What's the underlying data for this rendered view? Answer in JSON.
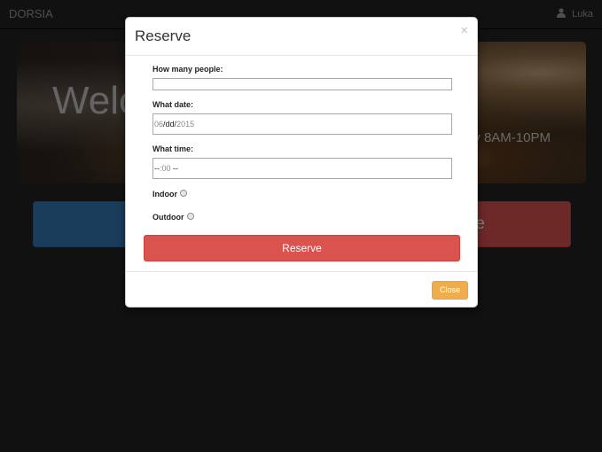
{
  "navbar": {
    "brand": "DORSIA",
    "user_name": "Luka",
    "user_icon": "user-icon"
  },
  "hero": {
    "title": "Welco",
    "hours_text": "y 8AM-10PM"
  },
  "background_buttons": {
    "red_label": "e"
  },
  "modal": {
    "title": "Reserve",
    "close_x": "×",
    "people": {
      "label": "How many people:",
      "value": ""
    },
    "date": {
      "label": "What date:",
      "month": "06",
      "sep1": "/",
      "day": "dd",
      "sep2": "/",
      "year": "2015"
    },
    "time": {
      "label": "What time:",
      "hour": "--",
      "sep": ":",
      "minute": "00",
      "ampm": " --"
    },
    "indoor_label": "Indoor",
    "outdoor_label": "Outdoor",
    "reserve_button": "Reserve",
    "close_button": "Close"
  },
  "colors": {
    "reserve": "#d9534f",
    "close": "#f0ad4e",
    "primary": "#337ab7",
    "navbar": "#222222"
  }
}
